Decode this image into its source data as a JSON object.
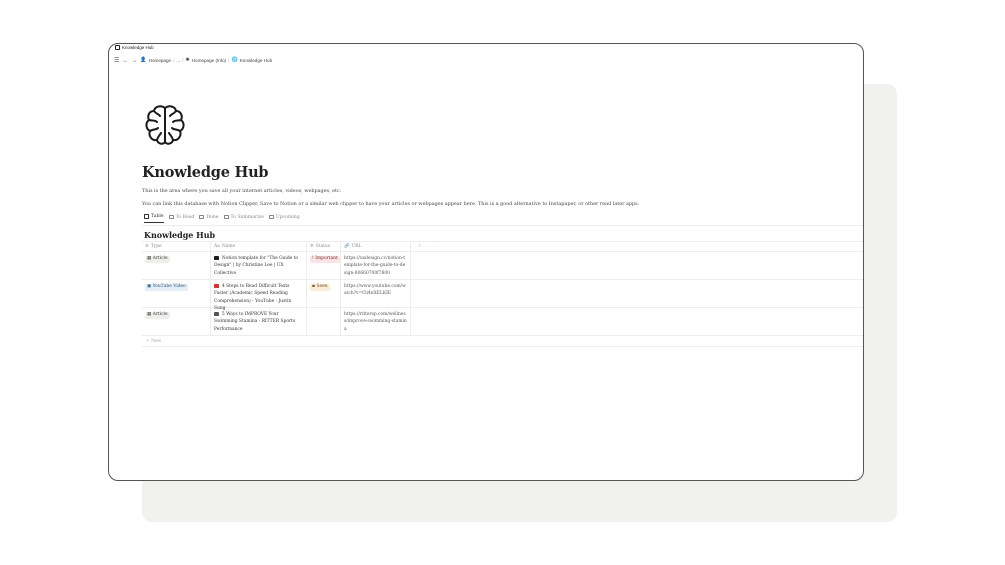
{
  "window": {
    "title": "Knowledge Hub"
  },
  "breadcrumb": [
    {
      "icon": "person-icon",
      "label": "Homepage"
    },
    {
      "icon": "",
      "label": "..."
    },
    {
      "icon": "sparkle-icon",
      "label": "Homepage (Info)"
    },
    {
      "icon": "globe-icon",
      "label": "Knowledge Hub"
    }
  ],
  "page": {
    "title": "Knowledge Hub",
    "icon": "brain-icon",
    "desc1": "This is the area where you save all your internet articles, videos, webpages, etc.",
    "desc2": "You can link this database with Notion Clipper, Save to Notion or a similar web clipper to have your articles or webpages appear here. This is a good alternative to Instapaper, or other read later apps."
  },
  "tabs": [
    {
      "label": "Table",
      "active": true
    },
    {
      "label": "To Read",
      "active": false
    },
    {
      "label": "Done",
      "active": false
    },
    {
      "label": "To Summarize",
      "active": false
    },
    {
      "label": "Upcoming",
      "active": false
    }
  ],
  "database": {
    "title": "Knowledge Hub",
    "columns": {
      "type": "Type",
      "name": "Name",
      "status": "Status",
      "url": "URL"
    },
    "add_column": "+ ···",
    "rows": [
      {
        "type": "Article",
        "name": "Notion template for \"The Guide to Design\" | by Christine Lee | UX Collective",
        "status": "Important",
        "url": "https://uxdesign.cc/notion-template-for-the-guide-to-design-80660700f7800"
      },
      {
        "type": "YouTube Video",
        "name": "4 Steps to Read Difficult Texts Faster (Academic Speed Reading Comprehension) - YouTube · Justin Sung",
        "status": "Seen",
        "url": "https://www.youtube.com/watch?v=f3i4nXELKIE"
      },
      {
        "type": "Article",
        "name": "5 Ways to IMPROVE Your Swimming Stamina - RITTER Sports Performance",
        "status": "",
        "url": "https://rittersp.com/wellness/improve-swimming-stamina"
      }
    ],
    "new_label": "+ New"
  },
  "colors": {
    "important_bg": "#fbe4e4",
    "seen_bg": "#faeed6",
    "video_bg": "#e3eef7",
    "article_bg": "#eeeeec"
  }
}
